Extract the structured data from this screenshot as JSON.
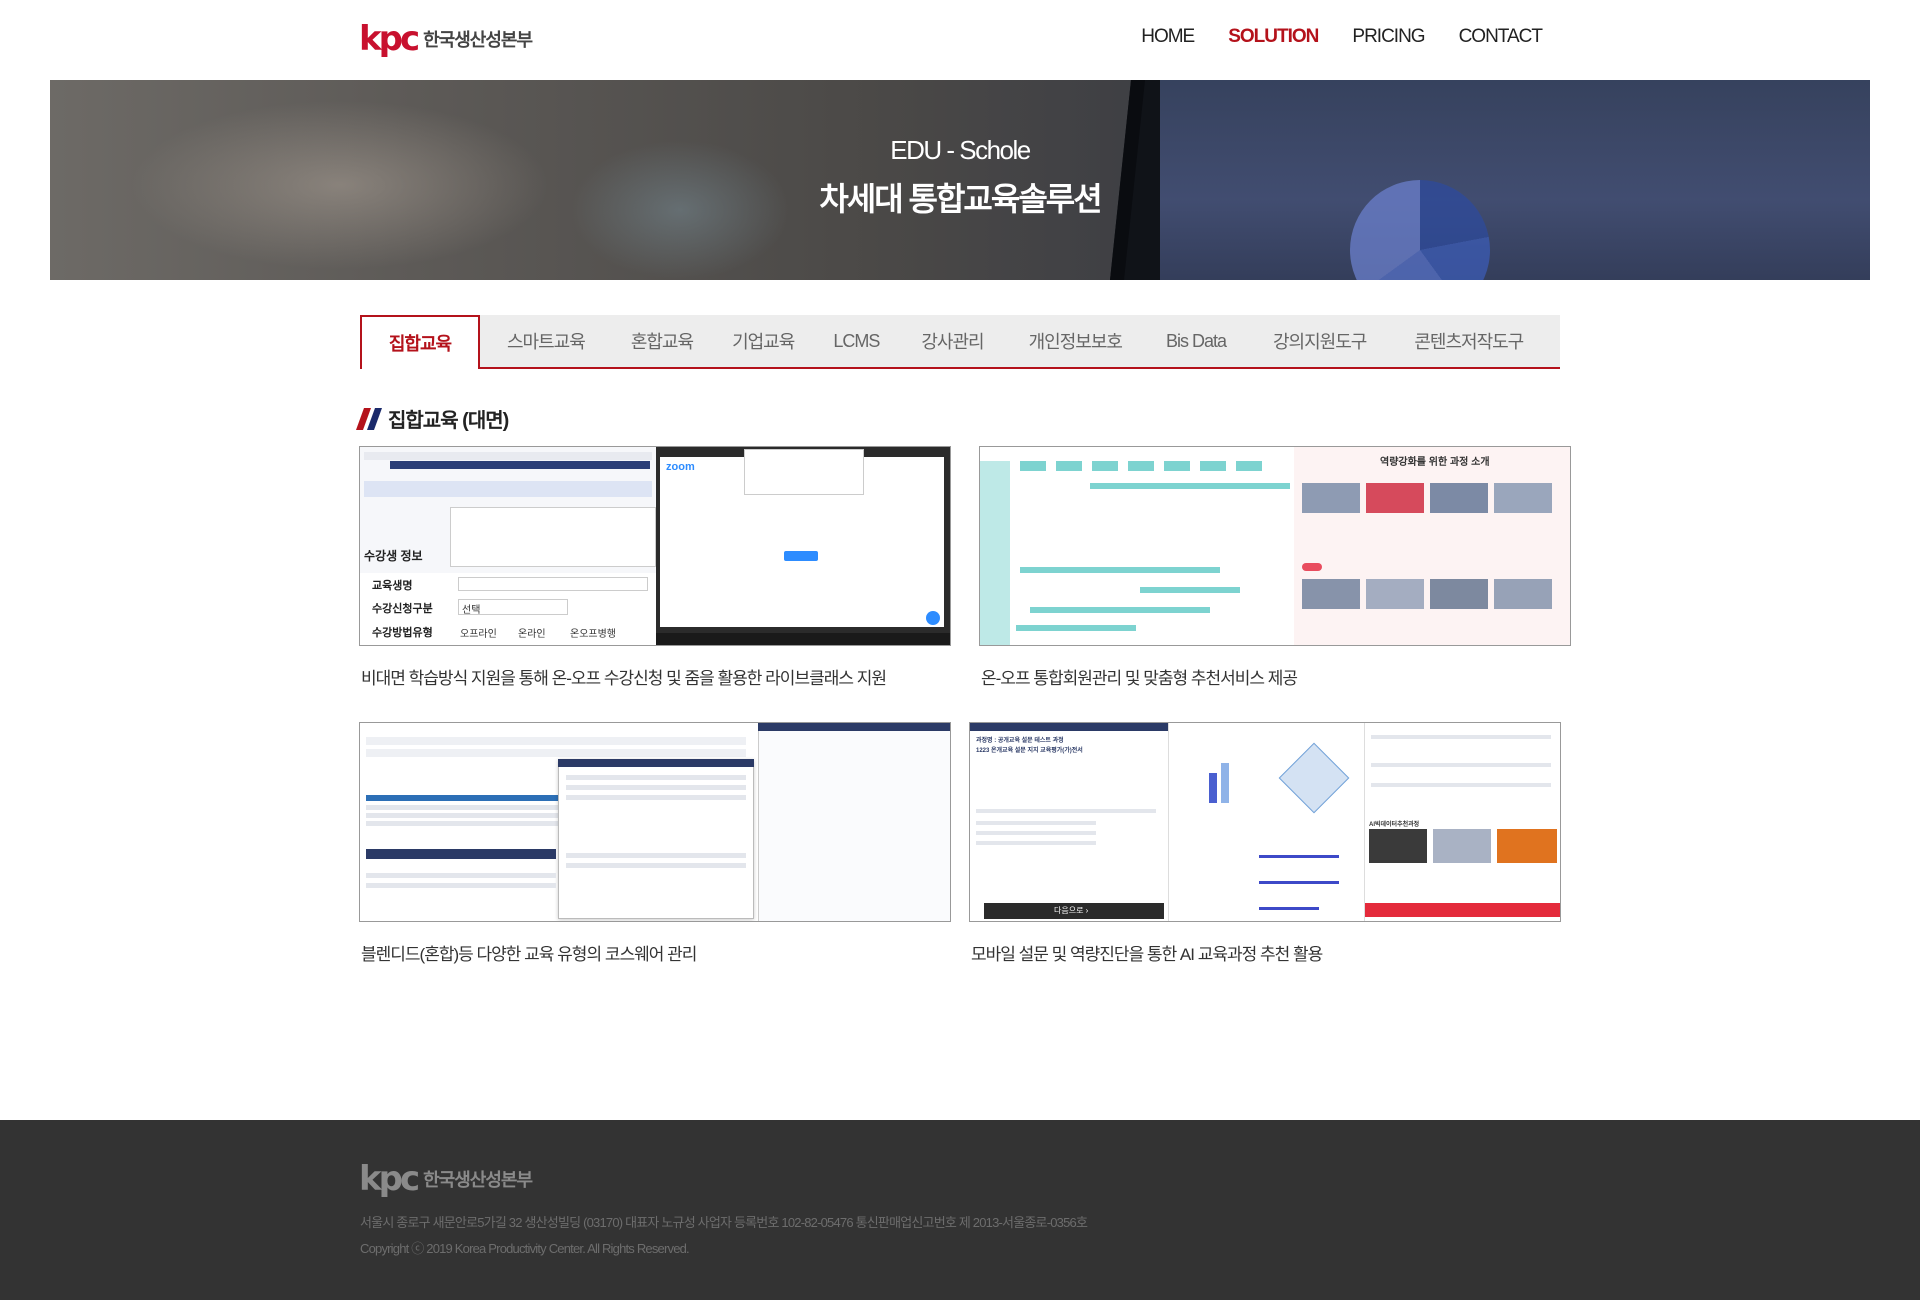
{
  "header": {
    "logo_mark": "kpc",
    "logo_text": "한국생산성본부",
    "nav": [
      {
        "label": "HOME"
      },
      {
        "label": "SOLUTION",
        "active": true
      },
      {
        "label": "PRICING"
      },
      {
        "label": "CONTACT"
      }
    ]
  },
  "hero": {
    "tagline": "EDU - Schole",
    "title": "차세대 통합교육솔루션"
  },
  "tabs": [
    {
      "label": "집합교육",
      "active": true
    },
    {
      "label": "스마트교육"
    },
    {
      "label": "혼합교육"
    },
    {
      "label": "기업교육"
    },
    {
      "label": "LCMS"
    },
    {
      "label": "강사관리"
    },
    {
      "label": "개인정보보호"
    },
    {
      "label": "Bis Data"
    },
    {
      "label": "강의지원도구"
    },
    {
      "label": "콘텐츠저작도구"
    }
  ],
  "section": {
    "title": "집합교육 (대면)"
  },
  "cards": [
    {
      "caption": "비대면 학습방식 지원을 통해 온-오프 수강신청 및 줌을 활용한 라이브클래스 지원",
      "shot": {
        "label1": "수강생 정보",
        "label2": "교육생명",
        "label3": "수강신청구분",
        "label4": "수강방법유형",
        "select": "선택",
        "radio1": "오프라인",
        "radio2": "온라인",
        "radio3": "온오프병행",
        "zoom": "zoom"
      }
    },
    {
      "caption": "온-오프 통합회원관리 및 맞춤형 추천서비스 제공",
      "shot": {
        "heading": "역량강화를 위한 과정 소개"
      }
    },
    {
      "caption": "블렌디드(혼합)등 다양한 교육 유형의 코스웨어 관리",
      "shot": {}
    },
    {
      "caption": "모바일 설문 및 역량진단을 통한 AI 교육과정 추천 활용",
      "shot": {
        "heading": "과정명 : 공개교육 설문 테스트 과정",
        "subheading": "1223 온개교육 설문 지지 교육평가(가)전서",
        "next": "다음으로 ›",
        "ai": "AI빅데이터추천과정"
      }
    }
  ],
  "footer": {
    "logo_mark": "kpc",
    "logo_text": "한국생산성본부",
    "address": "서울시 종로구 새문안로5가길 32 생산성빌딩 (03170) 대표자 노규성 사업자 등록번호 102-82-05476 통신판매업신고번호 제 2013-서울종로-0356호",
    "copyright": "Copyright ⓒ 2019 Korea Productivity Center. All Rights Reserved."
  },
  "colors": {
    "brand_red": "#b4121b",
    "navy": "#1b2a6b",
    "footer_bg": "#333333"
  }
}
